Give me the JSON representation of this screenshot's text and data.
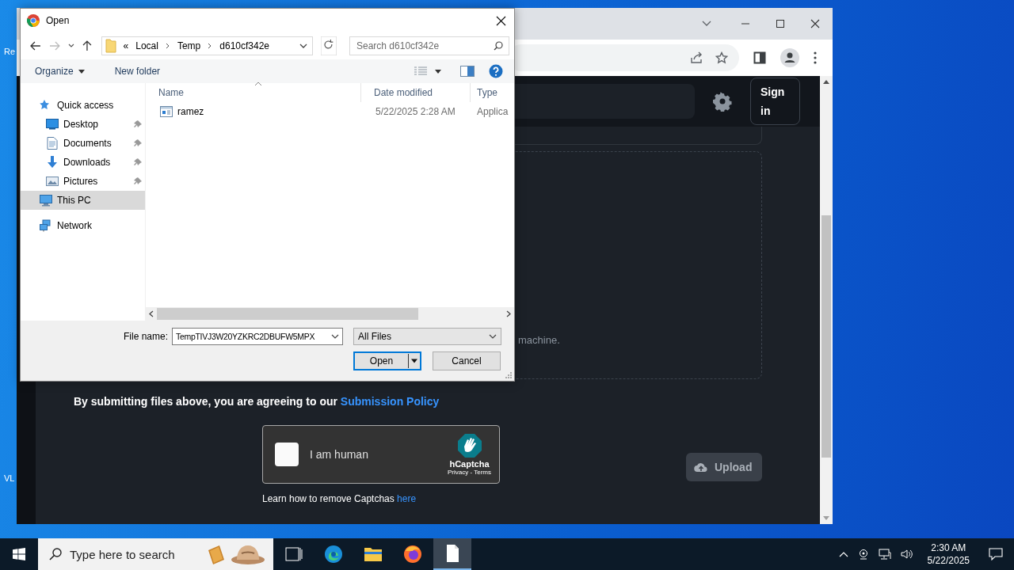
{
  "desktop": {
    "icons": [
      {
        "label": "Re"
      },
      {
        "label": "VL"
      }
    ]
  },
  "browser": {
    "page": {
      "sign_in": "Sign in",
      "upload_hint": "machine.",
      "policy_text": "By submitting files above, you are agreeing to our",
      "policy_link": "Submission Policy",
      "captcha": {
        "checked": false,
        "label": "I am human",
        "brand": "hCaptcha",
        "links": "Privacy - Terms"
      },
      "upload_button": {
        "label": "Upload",
        "disabled": true
      },
      "captcha_help": "Learn how to remove Captchas",
      "captcha_help_link": "here"
    }
  },
  "dialog": {
    "title": "Open",
    "breadcrumb_prefix": "«",
    "breadcrumb": [
      "Local",
      "Temp",
      "d610cf342e"
    ],
    "search": {
      "placeholder": "Search d610cf342e"
    },
    "toolbar": [
      {
        "label": "Organize",
        "kind": "menu"
      },
      {
        "label": "New folder",
        "kind": "button"
      }
    ],
    "nav": [
      {
        "label": "Quick access",
        "selected": false,
        "children": [
          {
            "label": "Desktop",
            "pinned": true,
            "selected": false
          },
          {
            "label": "Documents",
            "pinned": true,
            "selected": false
          },
          {
            "label": "Downloads",
            "pinned": true,
            "selected": false
          },
          {
            "label": "Pictures",
            "pinned": true,
            "selected": false
          }
        ]
      },
      {
        "label": "This PC",
        "selected": true
      },
      {
        "label": "Network",
        "selected": false
      }
    ],
    "columns": [
      "Name",
      "Date modified",
      "Type"
    ],
    "rows": [
      {
        "name": "ramez",
        "date": "5/22/2025 2:28 AM",
        "type": "Applica"
      }
    ],
    "file_name_label": "File name:",
    "file_name": "TempTIVJ3W20YZKRC2DBUFW5MPX",
    "filter": "All Files",
    "buttons": [
      {
        "label": "Open",
        "kind": "split"
      },
      {
        "label": "Cancel",
        "kind": "plain"
      }
    ]
  },
  "taskbar": {
    "search": {
      "placeholder": "Type here to search"
    },
    "apps": [
      {
        "selected": false
      },
      {
        "selected": false
      },
      {
        "selected": false
      },
      {
        "selected": false
      },
      {
        "selected": true
      }
    ],
    "time": "2:30 AM",
    "date": "5/22/2025"
  }
}
